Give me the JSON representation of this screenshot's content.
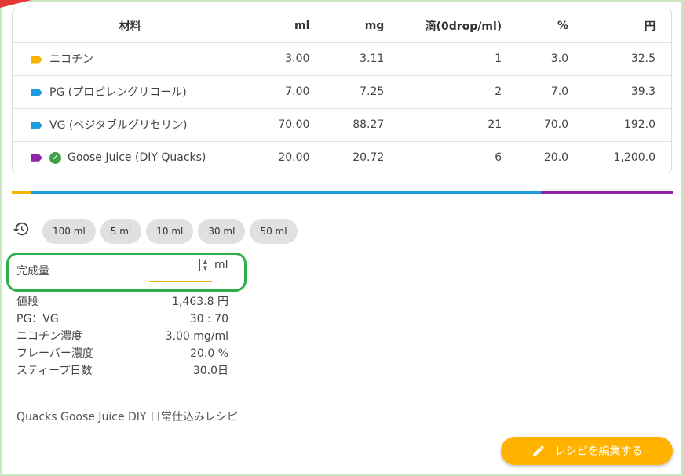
{
  "table": {
    "headers": [
      "材料",
      "ml",
      "mg",
      "滴(0drop/ml)",
      "%",
      "円"
    ],
    "rows": [
      {
        "color": "#f5b400",
        "verified": false,
        "name": "ニコチン",
        "ml": "3.00",
        "mg": "3.11",
        "drops": "1",
        "percent": "3.0",
        "yen": "32.5"
      },
      {
        "color": "#1e9be0",
        "verified": false,
        "name": "PG (プロピレングリコール)",
        "ml": "7.00",
        "mg": "7.25",
        "drops": "2",
        "percent": "7.0",
        "yen": "39.3"
      },
      {
        "color": "#1e9be0",
        "verified": false,
        "name": "VG (ベジタブルグリセリン)",
        "ml": "70.00",
        "mg": "88.27",
        "drops": "21",
        "percent": "70.0",
        "yen": "192.0"
      },
      {
        "color": "#8e24aa",
        "verified": true,
        "name": "Goose Juice (DIY Quacks)",
        "ml": "20.00",
        "mg": "20.72",
        "drops": "6",
        "percent": "20.0",
        "yen": "1,200.0"
      }
    ]
  },
  "composition_bar": [
    {
      "color": "#f5b400",
      "percent": 3
    },
    {
      "color": "#1e9be0",
      "percent": 77
    },
    {
      "color": "#8e24aa",
      "percent": 20
    }
  ],
  "quick_amounts": [
    "100 ml",
    "5 ml",
    "10 ml",
    "30 ml",
    "50 ml"
  ],
  "final_amount": {
    "label": "完成量",
    "value": "",
    "unit": "ml"
  },
  "stats": [
    {
      "label": "値段",
      "value": "1,463.8 円"
    },
    {
      "label": "PG：VG",
      "value": "30 : 70"
    },
    {
      "label": "ニコチン濃度",
      "value": "3.00 mg/ml"
    },
    {
      "label": "フレーバー濃度",
      "value": "20.0 %"
    },
    {
      "label": "スティープ日数",
      "value": "30.0日"
    }
  ],
  "description": "Quacks Goose Juice DIY 日常仕込みレシピ",
  "edit_button_label": "レシピを編集する",
  "accent_color": "#ffb300",
  "highlight_color": "#2db04a"
}
